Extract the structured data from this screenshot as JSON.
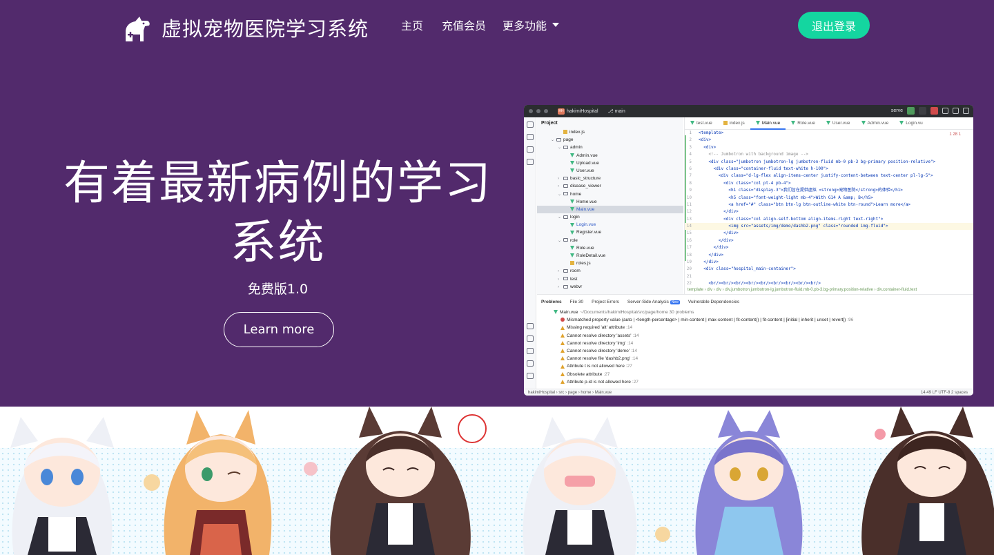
{
  "navbar": {
    "brand_title": "虚拟宠物医院学习系统",
    "links": [
      "主页",
      "充值会员",
      "更多功能"
    ],
    "logout_label": "退出登录"
  },
  "hero": {
    "title_line1": "有着最新病例的学习",
    "title_line2": "系统",
    "subtitle": "免费版1.0",
    "cta_label": "Learn more"
  },
  "ide": {
    "project_badge": "HH",
    "project_name": "hakimiHospital",
    "branch": "main",
    "run_config": "serve",
    "panel_title": "Project",
    "tree": [
      {
        "label": "index.js",
        "kind": "js"
      },
      {
        "label": "page",
        "kind": "folder"
      },
      {
        "label": "admin",
        "kind": "folder"
      },
      {
        "label": "Admin.vue",
        "kind": "vue"
      },
      {
        "label": "Upload.vue",
        "kind": "vue"
      },
      {
        "label": "User.vue",
        "kind": "vue"
      },
      {
        "label": "basic_structure",
        "kind": "folder"
      },
      {
        "label": "disease_viewer",
        "kind": "folder"
      },
      {
        "label": "home",
        "kind": "folder"
      },
      {
        "label": "Home.vue",
        "kind": "vue"
      },
      {
        "label": "Main.vue",
        "kind": "vue"
      },
      {
        "label": "login",
        "kind": "folder"
      },
      {
        "label": "Login.vue",
        "kind": "vue"
      },
      {
        "label": "Register.vue",
        "kind": "vue"
      },
      {
        "label": "role",
        "kind": "folder"
      },
      {
        "label": "Role.vue",
        "kind": "vue"
      },
      {
        "label": "RoleDetail.vue",
        "kind": "vue"
      },
      {
        "label": "roles.js",
        "kind": "js"
      },
      {
        "label": "room",
        "kind": "folder"
      },
      {
        "label": "test",
        "kind": "folder"
      },
      {
        "label": "webvr",
        "kind": "folder"
      }
    ],
    "tabs": [
      "test.vue",
      "index.js",
      "Main.vue",
      "Role.vue",
      "User.vue",
      "Admin.vue",
      "Login.vu"
    ],
    "problem_counts": "1  28  1",
    "code_lines": [
      "<template>",
      "<div>",
      "  <div>",
      "    <!-- Jumbotron with background image -->",
      "    <div class=\"jumbotron jumbotron-lg jumbotron-fluid mb-0 pb-3 bg-primary position-relative\">",
      "      <div class=\"container-fluid text-white h-100\">",
      "        <div class=\"d-lg-flex align-items-center justify-content-between text-center pl-lg-5\">",
      "          <div class=\"col pt-4 pb-4\">",
      "            <h1 class=\"display-3\">我们旨在提供虚拟 <strong>宠物医院</strong>的体验</h1>",
      "            <h5 class=\"font-weight-light mb-4\">With G14 A &amp; B</h5>",
      "            <a href=\"#\" class=\"btn btn-lg btn-outline-white btn-round\">Learn more</a>",
      "          </div>",
      "          <div class=\"col align-self-bottom align-items-right text-right\">",
      "            <img src=\"assets/img/demo/dashb2.png\" class=\"rounded img-fluid\">",
      "          </div>",
      "        </div>",
      "      </div>",
      "    </div>",
      "  </div>",
      "  <div class=\"hospital_main-container\">",
      "",
      "    <br/><br/><br/><br/><br/><br/><br/><br/><br/>"
    ],
    "code_breadcrumb": "template › div › div › div.jumbotron.jumbotron-lg.jumbotron-fluid.mb-0.pb-3.bg-primary.position-relative › div.container-fluid.text",
    "problem_tabs": [
      "Problems",
      "File 30",
      "Project Errors",
      "Server-Side Analysis",
      "Vulnerable Dependencies"
    ],
    "new_badge": "New",
    "problem_file": "Main.vue",
    "problem_file_path": "~/Documents/hakimiHospital/src/page/home  30 problems",
    "problems": [
      {
        "sev": "error",
        "text": "Mismatched property value (auto | <length-percentage> | min-content | max-content | fit-content() | fit-content | [initial | inherit | unset | revert])",
        "line": ":96"
      },
      {
        "sev": "warn",
        "text": "Missing required 'alt' attribute",
        "line": ":14"
      },
      {
        "sev": "warn",
        "text": "Cannot resolve directory 'assets'",
        "line": ":14"
      },
      {
        "sev": "warn",
        "text": "Cannot resolve directory 'img'",
        "line": ":14"
      },
      {
        "sev": "warn",
        "text": "Cannot resolve directory 'demo'",
        "line": ":14"
      },
      {
        "sev": "warn",
        "text": "Cannot resolve file 'dashb2.png'",
        "line": ":14"
      },
      {
        "sev": "warn",
        "text": "Attribute t is not allowed here",
        "line": ":27"
      },
      {
        "sev": "warn",
        "text": "Obsolete attribute",
        "line": ":27"
      },
      {
        "sev": "warn",
        "text": "Attribute p-id is not allowed here",
        "line": ":27"
      }
    ],
    "status_path": "hakimiHospital › src › page › home › Main.vue",
    "status_right": "14:49   LF   UTF-8   2 spaces"
  },
  "colors": {
    "page_bg": "#522a6c",
    "accent": "#14d6a0",
    "banner_bg": "#f3fbff"
  },
  "icons": {
    "brand": "dog-medical-cross-logo",
    "dropdown": "caret-down-icon"
  }
}
